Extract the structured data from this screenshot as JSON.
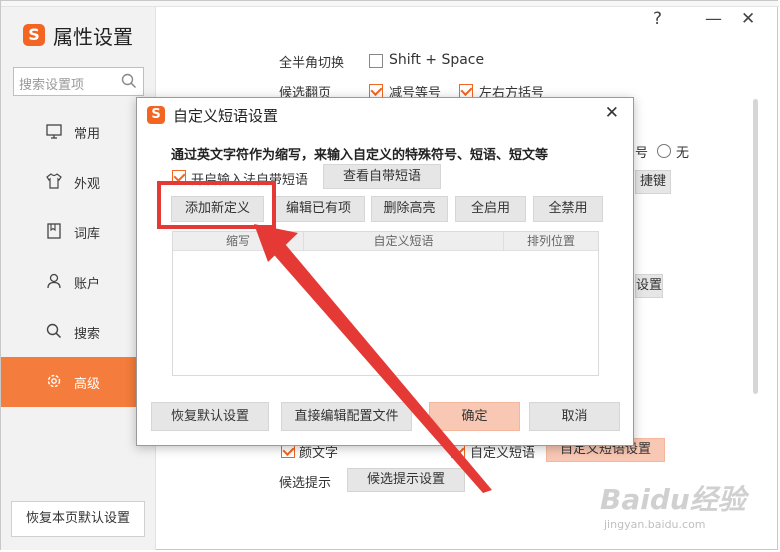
{
  "app": {
    "title": "属性设置",
    "logo": "S"
  },
  "window_controls": {
    "help": "?",
    "minimize": "—",
    "close": "✕"
  },
  "search": {
    "placeholder": "搜索设置项"
  },
  "sidebar": {
    "items": [
      {
        "label": "常用",
        "icon": "monitor-icon",
        "active": false
      },
      {
        "label": "外观",
        "icon": "shirt-icon",
        "active": false
      },
      {
        "label": "词库",
        "icon": "book-icon",
        "active": false
      },
      {
        "label": "账户",
        "icon": "person-icon",
        "active": false
      },
      {
        "label": "搜索",
        "icon": "search-icon",
        "active": false
      },
      {
        "label": "高级",
        "icon": "gear-icon",
        "active": true
      }
    ],
    "restore_label": "恢复本页默认设置"
  },
  "background": {
    "fullwidth_label": "全半角切换",
    "fullwidth_option": "Shift + Space",
    "fullwidth_checked": false,
    "paging_label": "候选翻页",
    "paging_opt1": "减号等号",
    "paging_opt2": "左右方括号",
    "radio_suffix": "号",
    "radio_none": "无",
    "shortcut_btn": "捷键",
    "settings_btn": "设置",
    "kaomoji_label": "颜文字",
    "custom_phrase_label": "自定义短语",
    "custom_phrase_btn": "自定义短语设置",
    "hint_label": "候选提示",
    "hint_btn": "候选提示设置"
  },
  "dialog": {
    "logo": "S",
    "title": "自定义短语设置",
    "close": "✕",
    "description": "通过英文字符作为缩写，来输入自定义的特殊符号、短语、短文等",
    "enable_builtin_label": "开启输入法自带短语",
    "enable_builtin_checked": true,
    "view_builtin_btn": "查看自带短语",
    "toolbar": {
      "add": "添加新定义",
      "edit": "编辑已有项",
      "delete": "删除高亮",
      "enable_all": "全启用",
      "disable_all": "全禁用"
    },
    "table": {
      "columns": [
        "缩写",
        "自定义短语",
        "排列位置"
      ],
      "rows": []
    },
    "footer": {
      "restore": "恢复默认设置",
      "edit_config": "直接编辑配置文件",
      "ok": "确定",
      "cancel": "取消"
    }
  },
  "annotation": {
    "color": "#e53935"
  },
  "watermark": {
    "text": "Baidu经验",
    "url": "jingyan.baidu.com"
  },
  "colors": {
    "accent": "#f26522",
    "active_nav": "#f47c3c",
    "primary_btn": "#f9c8b4"
  }
}
